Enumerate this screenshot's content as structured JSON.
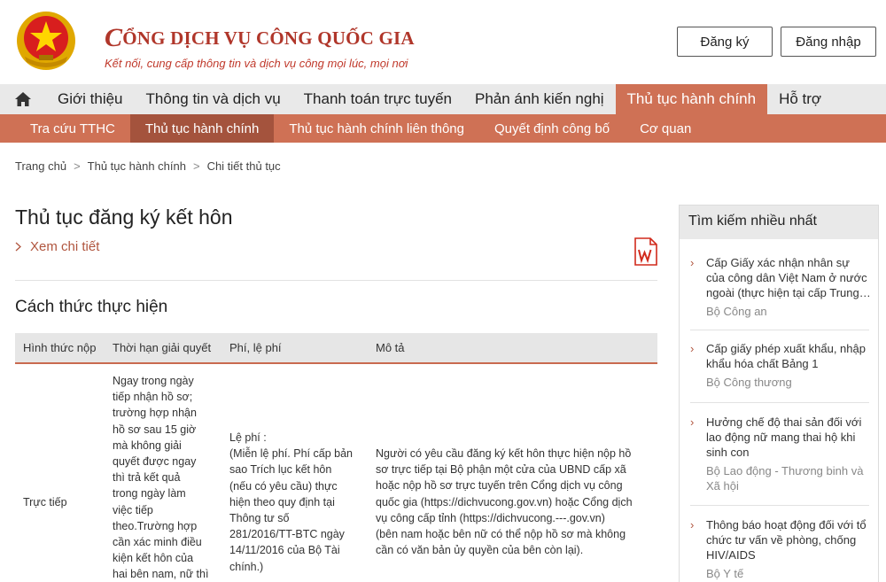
{
  "header": {
    "brand_initial": "C",
    "brand_rest": "ỔNG DỊCH VỤ CÔNG QUỐC GIA",
    "tagline": "Kết nối, cung cấp thông tin và dịch vụ công mọi lúc, mọi nơi",
    "register_label": "Đăng ký",
    "login_label": "Đăng nhập"
  },
  "main_nav": {
    "items": [
      {
        "label": "Giới thiệu"
      },
      {
        "label": "Thông tin và dịch vụ"
      },
      {
        "label": "Thanh toán trực tuyến"
      },
      {
        "label": "Phản ánh kiến nghị"
      },
      {
        "label": "Thủ tục hành chính"
      },
      {
        "label": "Hỗ trợ"
      }
    ],
    "active_index": 4
  },
  "sub_nav": {
    "items": [
      {
        "label": "Tra cứu TTHC"
      },
      {
        "label": "Thủ tục hành chính"
      },
      {
        "label": "Thủ tục hành chính liên thông"
      },
      {
        "label": "Quyết định công bố"
      },
      {
        "label": "Cơ quan"
      }
    ],
    "active_index": 1
  },
  "breadcrumb": {
    "items": [
      "Trang chủ",
      "Thủ tục hành chính",
      "Chi tiết thủ tục"
    ],
    "separator": ">"
  },
  "procedure": {
    "title": "Thủ tục đăng ký kết hôn",
    "detail_link": "Xem chi tiết",
    "section_title": "Cách thức thực hiện"
  },
  "table": {
    "headers": [
      "Hình thức nộp",
      "Thời hạn giải quyết",
      "Phí, lệ phí",
      "Mô tả"
    ],
    "row": {
      "method": "Trực tiếp",
      "deadline_lines": [
        "Ngay trong ngày",
        "tiếp nhận hồ sơ;",
        "trường hợp nhận",
        "hồ sơ sau 15 giờ",
        "mà không giải",
        "quyết được ngay",
        "thì trả kết quả",
        "trong ngày làm",
        "việc tiếp",
        "theo.Trường hợp",
        "cần xác minh điều",
        "kiện kết hôn của",
        "hai bên nam, nữ thì"
      ],
      "fee_lines": [
        "Lệ phí :",
        "(Miễn lệ phí. Phí cấp bản",
        "sao Trích lục kết hôn",
        "(nếu có yêu cầu) thực",
        "hiện theo quy định tại",
        "Thông tư số",
        "281/2016/TT-BTC ngày",
        "14/11/2016 của Bộ Tài",
        "chính.)"
      ],
      "description_lines": [
        "Người có yêu cầu đăng ký kết hôn thực hiện nộp hồ",
        "sơ trực tiếp tại Bộ phận một cửa của UBND cấp xã",
        "hoặc nộp hồ sơ trực tuyến trên Cổng dịch vụ công",
        "quốc gia (https://dichvucong.gov.vn) hoặc Cổng dịch",
        "vụ công cấp tỉnh (https://dichvucong.---.gov.vn)",
        "(bên nam hoặc bên nữ có thể nộp hồ sơ mà không",
        "cần có văn bản ủy quyền của bên còn lại)."
      ]
    }
  },
  "sidebar": {
    "title": "Tìm kiếm nhiều nhất",
    "items": [
      {
        "title_lines": [
          "Cấp Giấy xác nhận nhân sự",
          "của công dân Việt Nam ở nước",
          "ngoài (thực hiện tại cấp Trung…"
        ],
        "agency_lines": [
          "Bộ Công an"
        ]
      },
      {
        "title_lines": [
          "Cấp giấy phép xuất khẩu, nhập",
          "khẩu hóa chất Bảng 1"
        ],
        "agency_lines": [
          "Bộ Công thương"
        ]
      },
      {
        "title_lines": [
          "Hưởng chế độ thai sản đối với",
          "lao động nữ mang thai hộ khi",
          "sinh con"
        ],
        "agency_lines": [
          "Bộ Lao động - Thương binh và",
          "Xã hội"
        ]
      },
      {
        "title_lines": [
          "Thông báo hoạt động đối với tổ",
          "chức tư vấn về phòng, chống",
          "HIV/AIDS"
        ],
        "agency_lines": [
          "Bộ Y tế"
        ]
      }
    ]
  },
  "colors": {
    "brand_red": "#b0362a",
    "nav_accent": "#cf7155",
    "nav_active_dark": "#a4533d",
    "nav_bg": "#e9e9e9"
  },
  "icons": {
    "emblem": "national-emblem",
    "home": "home-icon",
    "word": "word-document-icon",
    "chevron": "chevron-right-icon"
  }
}
